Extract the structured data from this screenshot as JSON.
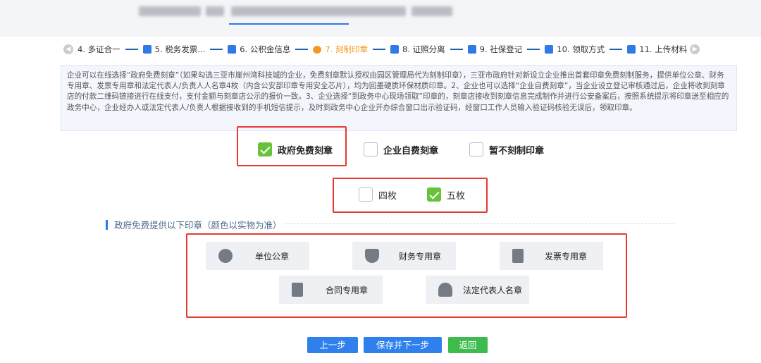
{
  "steps": [
    {
      "label": "4. 多证合一",
      "icon": "cert-icon",
      "active": false
    },
    {
      "label": "5. 税务发票...",
      "icon": "invoice-icon",
      "active": false
    },
    {
      "label": "6. 公积金信息",
      "icon": "card-icon",
      "active": false
    },
    {
      "label": "7. 刻制印章",
      "icon": "person-icon",
      "active": true
    },
    {
      "label": "8. 证照分离",
      "icon": "license-icon",
      "active": false
    },
    {
      "label": "9. 社保登记",
      "icon": "id-card-icon",
      "active": false
    },
    {
      "label": "10. 领取方式",
      "icon": "document-icon",
      "active": false
    },
    {
      "label": "11. 上传材料",
      "icon": "upload-icon",
      "active": false
    }
  ],
  "notice": "企业可以在线选择“政府免费刻章”（如果勾选三亚市崖州湾科技城的企业，免费刻章默认授权由园区管理局代为刻制印章），三亚市政府针对新设立企业推出首套印章免费刻制服务，提供单位公章、财务专用章、发票专用章和法定代表人/负责人人名章4枚（内含公安部印章专用安全芯片），均为回墨硬质环保材质印章。2、企业也可以选择“企业自费刻章”，当企业设立登记审核通过后，企业将收到刻章店的付款二维码链接进行在线支付，支付金额与刻章店公示的报价一致。3、企业选择“到政务中心现场领取”印章的，刻章店接收到刻章信息完成制作并进行公安备案后，按照系统提示将印章送至相应的政务中心，企业经办人或法定代表人/负责人根据接收到的手机短信提示，及时到政务中心企业开办综合窗口出示验证码，经窗口工作人员输入验证码核验无误后，领取印章。",
  "seal_options": [
    {
      "label": "政府免费刻章",
      "checked": true
    },
    {
      "label": "企业自费刻章",
      "checked": false
    },
    {
      "label": "暂不刻制印章",
      "checked": false
    }
  ],
  "count_options": [
    {
      "label": "四枚",
      "checked": false
    },
    {
      "label": "五枚",
      "checked": true
    }
  ],
  "section_title": "政府免费提供以下印章（颜色以实物为准）",
  "seals": [
    {
      "label": "单位公章",
      "icon": "star-seal-icon"
    },
    {
      "label": "财务专用章",
      "icon": "finance-shield-icon"
    },
    {
      "label": "发票专用章",
      "icon": "invoice-doc-icon"
    },
    {
      "label": "合同专用章",
      "icon": "contract-doc-icon"
    },
    {
      "label": "法定代表人名章",
      "icon": "legal-rep-icon"
    }
  ],
  "buttons": {
    "prev": "上一步",
    "save_next": "保存并下一步",
    "back": "返回"
  },
  "colors": {
    "accent": "#2f80ed",
    "active_step": "#f39b1f",
    "checked": "#67c23a",
    "highlight": "#e63a30",
    "back_button": "#3dbb4c"
  }
}
